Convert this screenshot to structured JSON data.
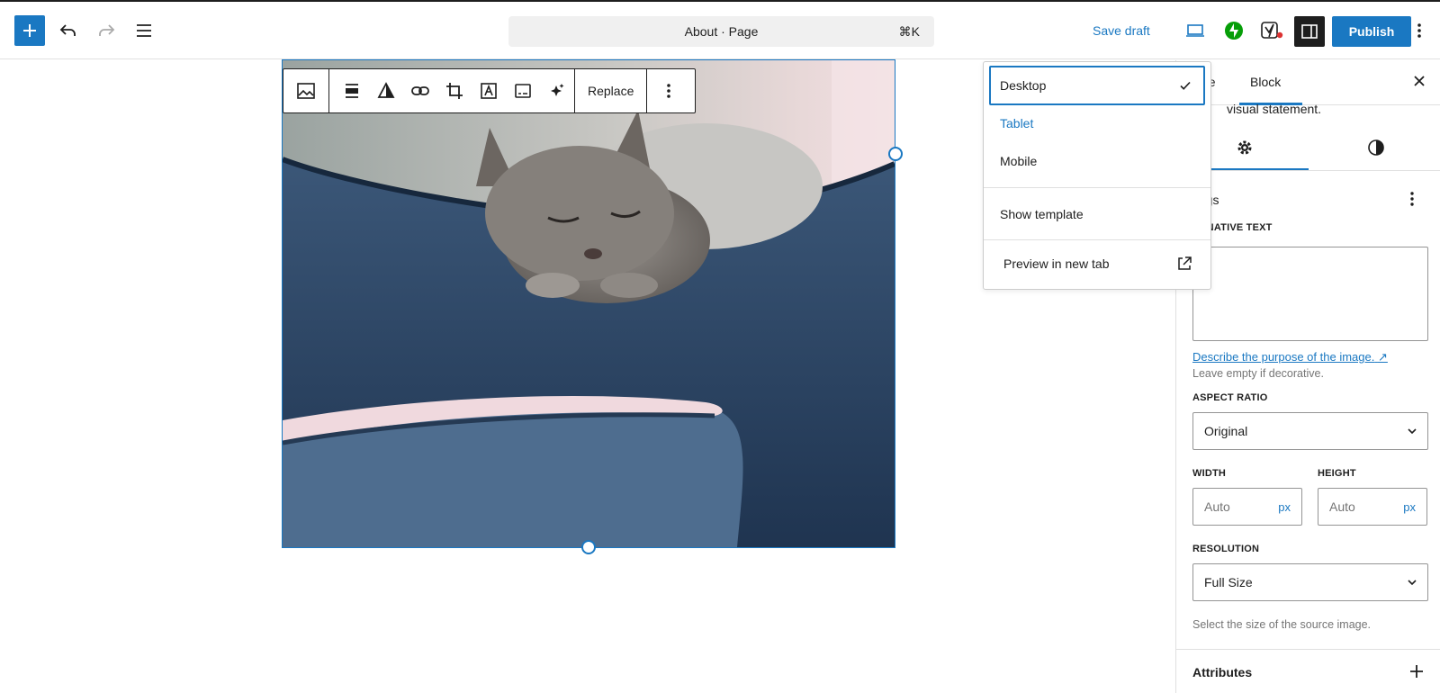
{
  "topbar": {
    "document_title": "About · Page",
    "shortcut": "⌘K",
    "save_draft_label": "Save draft",
    "publish_label": "Publish",
    "icons": [
      "plus-icon",
      "undo-icon",
      "redo-icon",
      "list-view-icon",
      "desktop-preview-icon",
      "jetpack-icon",
      "yoast-icon",
      "sidebar-icon",
      "more-vertical-icon"
    ]
  },
  "block_toolbar": {
    "replace_label": "Replace",
    "icons": [
      "image-block-icon",
      "align-icon",
      "duotone-icon",
      "link-icon",
      "crop-icon",
      "text-overlay-icon",
      "caption-icon",
      "sparkle-ai-icon",
      "more-vertical-icon"
    ]
  },
  "preview_menu": {
    "items": [
      {
        "label": "Desktop",
        "selected": true
      },
      {
        "label": "Tablet",
        "selected": false
      },
      {
        "label": "Mobile",
        "selected": false
      }
    ],
    "show_template_label": "Show template",
    "preview_new_tab_label": "Preview in new tab"
  },
  "sidebar": {
    "tab_page_partial": "ge",
    "tab_block": "Block",
    "description_partial": "visual statement.",
    "settings_heading_partial": "ttings",
    "alt_text_label_partial": "ERNATIVE TEXT",
    "alt_text_value": "",
    "describe_link": "Describe the purpose of the image.",
    "describe_link_arrow": "↗",
    "leave_empty_help": "Leave empty if decorative.",
    "aspect_ratio_label": "ASPECT RATIO",
    "aspect_ratio_value": "Original",
    "width_label": "WIDTH",
    "height_label": "HEIGHT",
    "width_placeholder": "Auto",
    "height_placeholder": "Auto",
    "unit": "px",
    "resolution_label": "RESOLUTION",
    "resolution_value": "Full Size",
    "resolution_help": "Select the size of the source image.",
    "attributes_label": "Attributes"
  },
  "colors": {
    "accent": "#1a78c2",
    "dark": "#1e1e1e"
  }
}
